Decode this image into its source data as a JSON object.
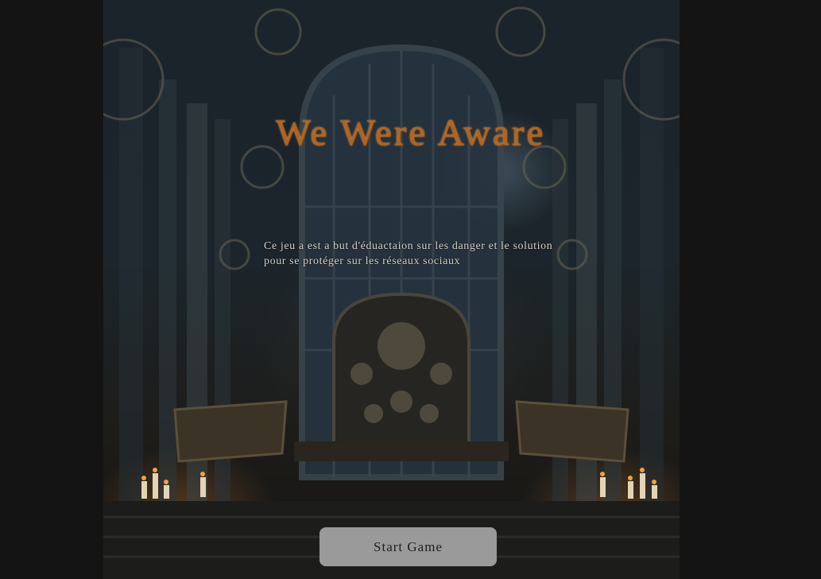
{
  "game": {
    "title": "We Were Aware",
    "description": "Ce jeu a est a but d'éduactaion sur les danger et le solution pour se protéger sur les réseaux sociaux",
    "start_button_label": "Start Game"
  },
  "background": {
    "scene": "steampunk-machine-room-illustration",
    "accent_color": "#b3631f"
  }
}
